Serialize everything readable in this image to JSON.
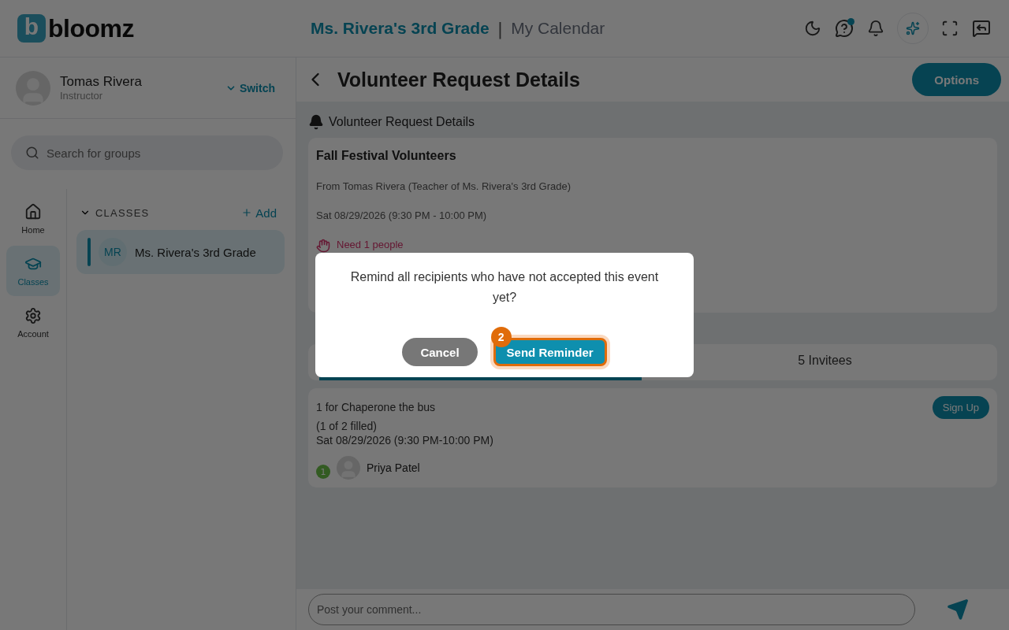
{
  "header": {
    "logo": {
      "mark": "b",
      "text": "bloomz"
    },
    "group_title": "Ms. Rivera's 3rd Grade",
    "separator": "|",
    "page_title": "My Calendar",
    "help_has_notification": true
  },
  "profile": {
    "name": "Tomas Rivera",
    "role": "Instructor",
    "switch_label": "Switch"
  },
  "search": {
    "placeholder": "Search for groups"
  },
  "nav": [
    {
      "label": "Home",
      "selected": false
    },
    {
      "label": "Classes",
      "selected": true
    },
    {
      "label": "Account",
      "selected": false
    }
  ],
  "classes": {
    "heading": "CLASSES",
    "expanded": true,
    "add_label": "Add",
    "items": [
      {
        "initials": "MR",
        "name": "Ms. Rivera's 3rd Grade",
        "selected": true
      }
    ]
  },
  "page": {
    "title": "Volunteer Request Details",
    "options_label": "Options",
    "section_title": "Volunteer Request Details"
  },
  "event": {
    "title": "Fall Festival Volunteers",
    "from": "From Tomas Rivera (Teacher of Ms. Rivera's 3rd Grade)",
    "date": "Sat 08/29/2026 (9:30 PM - 10:00 PM)",
    "need": "Need 1 people"
  },
  "tabs": [
    {
      "selected": true
    },
    {
      "label": "5 Invitees",
      "selected": false
    }
  ],
  "slots": [
    {
      "title": "1 for Chaperone the bus",
      "filled": "(1 of 2 filled)",
      "time": "Sat 08/29/2026 (9:30 PM-10:00 PM)",
      "signup_label": "Sign Up",
      "volunteers": [
        {
          "number": "1",
          "name": "Priya Patel"
        }
      ]
    }
  ],
  "comment": {
    "placeholder": "Post your comment..."
  },
  "dialog": {
    "message": "Remind all recipients who have not accepted this event yet?",
    "cancel_label": "Cancel",
    "confirm_label": "Send Reminder",
    "step_badge": "2"
  }
}
